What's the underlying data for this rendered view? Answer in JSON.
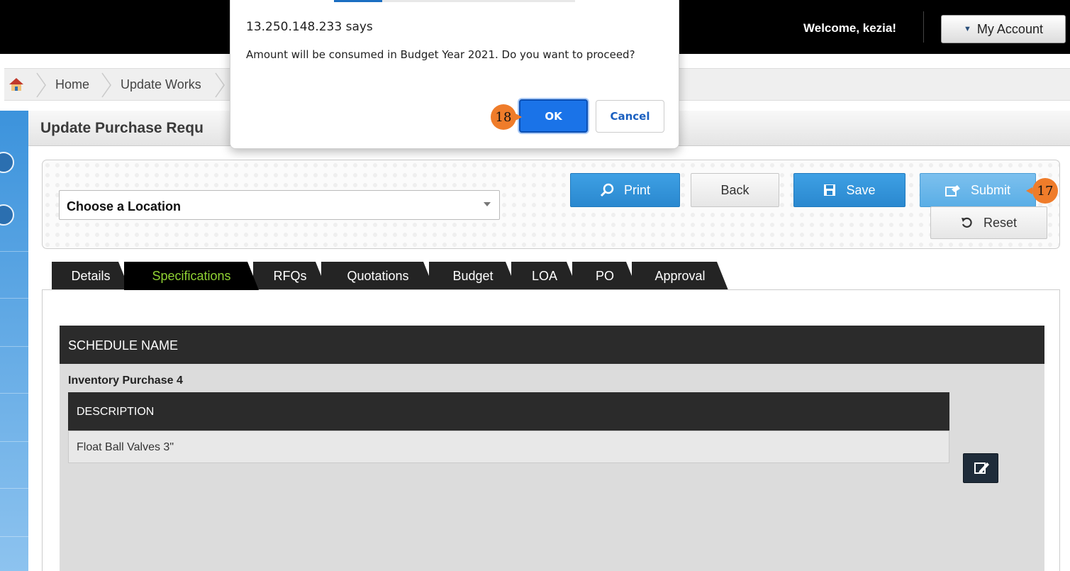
{
  "header": {
    "welcome_text": "Welcome, kezia!",
    "account_label": "My Account"
  },
  "breadcrumb": {
    "items": [
      "Home",
      "Update Works"
    ]
  },
  "page": {
    "title": "Update Purchase Requ"
  },
  "toolbar": {
    "location_select_value": "Choose a Location",
    "print_label": "Print",
    "back_label": "Back",
    "save_label": "Save",
    "submit_label": "Submit",
    "reset_label": "Reset"
  },
  "tabs": [
    {
      "label": "Details",
      "active": false
    },
    {
      "label": "Specifications",
      "active": true
    },
    {
      "label": "RFQs",
      "active": false
    },
    {
      "label": "Quotations",
      "active": false
    },
    {
      "label": "Budget",
      "active": false
    },
    {
      "label": "LOA",
      "active": false
    },
    {
      "label": "PO",
      "active": false
    },
    {
      "label": "Approval",
      "active": false
    }
  ],
  "schedule": {
    "header": "SCHEDULE NAME",
    "name": "Inventory Purchase 4",
    "description_header": "DESCRIPTION",
    "description_value": "Float Ball Valves 3\""
  },
  "dialog": {
    "origin": "13.250.148.233 says",
    "message": "Amount will be consumed in Budget Year 2021. Do you want to proceed?",
    "ok_label": "OK",
    "cancel_label": "Cancel"
  },
  "markers": {
    "submit_step": "17",
    "ok_step": "18"
  },
  "colors": {
    "marker": "#ef7c2a",
    "primary_button": "#2a88cf",
    "active_tab_text": "#8fd233",
    "dialog_ok": "#1a73e8"
  }
}
